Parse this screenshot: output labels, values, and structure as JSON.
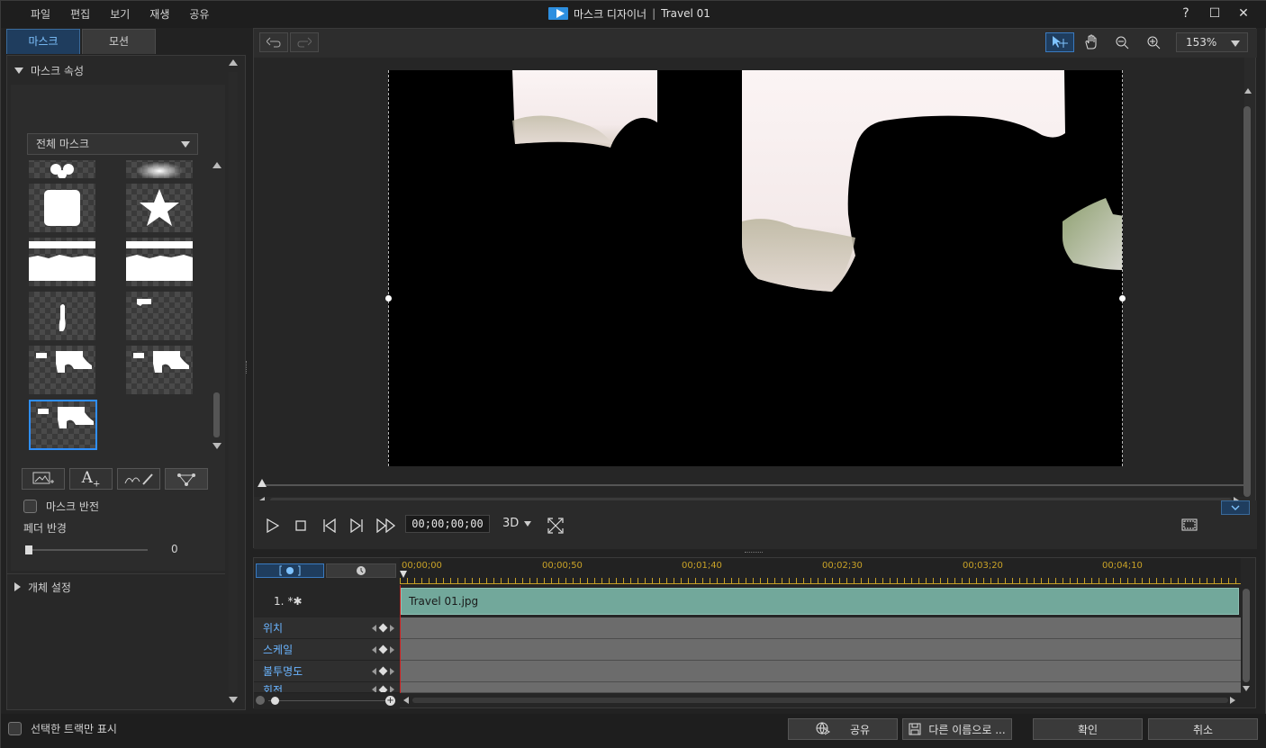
{
  "menu": [
    "파일",
    "편집",
    "보기",
    "재생",
    "공유"
  ],
  "window": {
    "app_name": "마스크 디자이너",
    "separator": "|",
    "project": "Travel 01"
  },
  "window_controls": {
    "help": "?",
    "maximize": "☐",
    "close": "✕"
  },
  "tabs": [
    {
      "label": "마스크",
      "active": true
    },
    {
      "label": "모션",
      "active": false
    }
  ],
  "mask_props": {
    "header": "마스크 속성",
    "dropdown_value": "전체 마스크",
    "invert_label": "마스크 반전",
    "invert_checked": false,
    "feather_label": "페더 반경",
    "feather_value": "0"
  },
  "object_settings": {
    "header": "개체 설정"
  },
  "viewer": {
    "zoom": "153%",
    "timecode": "00;00;00;00",
    "mode_3d": "3D"
  },
  "timeline": {
    "ruler": [
      "00;00;00",
      "00;00;50",
      "00;01;40",
      "00;02;30",
      "00;03;20",
      "00;04;10"
    ],
    "track_index": "1.",
    "track_marker": "*✱",
    "clip_name": "Travel 01.jpg",
    "properties": [
      "위치",
      "스케일",
      "불투명도",
      "회전"
    ]
  },
  "footer": {
    "show_selected_label": "선택한 트랙만 표시",
    "share": "공유",
    "save_as": "다른 이름으로 ...",
    "ok": "확인",
    "cancel": "취소"
  },
  "colors": {
    "accent": "#2f8fff",
    "clip": "#72a89b",
    "property_label": "#6ab4ff"
  }
}
